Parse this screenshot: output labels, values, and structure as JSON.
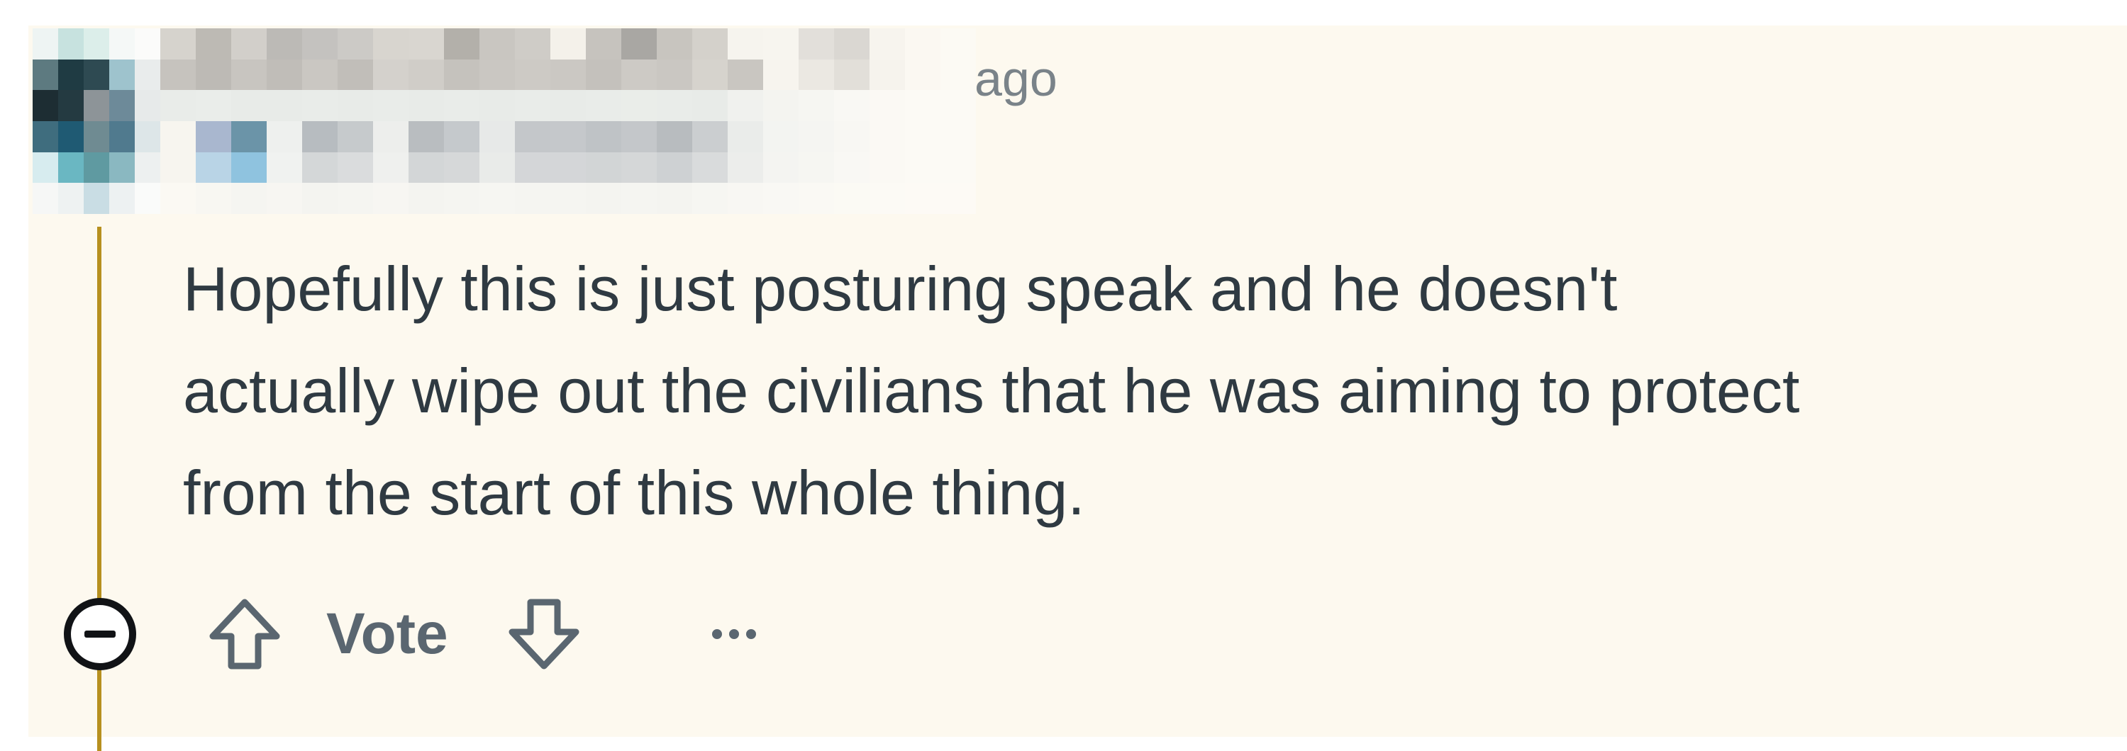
{
  "comment": {
    "timestamp_suffix": "ago",
    "body_lines": [
      "Hopefully this is just posturing speak and he doesn't",
      "actually wipe out the civilians that he was aiming to protect",
      "from the start of this whole thing."
    ]
  },
  "actions": {
    "vote_label": "Vote",
    "collapse_icon": "minus-circle-icon",
    "upvote_icon": "arrow-up-icon",
    "downvote_icon": "arrow-down-icon",
    "more_icon": "ellipsis-icon"
  },
  "colors": {
    "background": "#fdf9ef",
    "thread_line": "#b7901f",
    "text": "#2f3a42",
    "muted": "#7a8389"
  }
}
